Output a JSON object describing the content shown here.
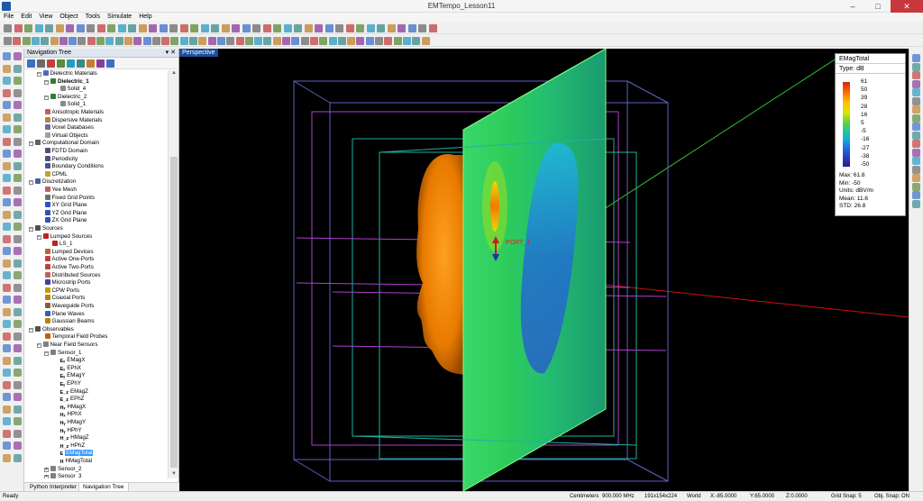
{
  "window": {
    "title": "EMTempo_Lesson11",
    "minimize": "–",
    "maximize": "□",
    "close": "✕"
  },
  "menus": [
    "File",
    "Edit",
    "View",
    "Object",
    "Tools",
    "Simulate",
    "Help"
  ],
  "nav": {
    "header": "Navigation Tree",
    "header_controls": "▾ ✕",
    "tabs": [
      "Python Interpreter",
      "Navigation Tree"
    ],
    "tree": [
      {
        "label": "Dielectric Materials",
        "level": 1,
        "exp": "−",
        "icon": "material-icon",
        "color": "#4a6cc0"
      },
      {
        "label": "Dielectric_1",
        "level": 2,
        "exp": "−",
        "icon": "material-icon",
        "color": "#2e7d32",
        "bold": true
      },
      {
        "label": "Solid_4",
        "level": 3,
        "icon": "solid-icon",
        "color": "#8a8a8a"
      },
      {
        "label": "Dielectric_2",
        "level": 2,
        "exp": "−",
        "icon": "material-icon",
        "color": "#2e7d32"
      },
      {
        "label": "Solid_1",
        "level": 3,
        "icon": "solid-icon",
        "color": "#8a8a8a"
      },
      {
        "label": "Anisotropic Materials",
        "level": 1,
        "icon": "material-icon",
        "color": "#c06060"
      },
      {
        "label": "Dispersive Materials",
        "level": 1,
        "icon": "material-icon",
        "color": "#c08040"
      },
      {
        "label": "Voxel Databases",
        "level": 1,
        "icon": "database-icon",
        "color": "#6070a0"
      },
      {
        "label": "Virtual Objects",
        "level": 1,
        "icon": "object-icon",
        "color": "#a0a0a0"
      },
      {
        "label": "Computational Domain",
        "level": 0,
        "exp": "−",
        "icon": "domain-icon",
        "color": "#606060"
      },
      {
        "label": "FDTD Domain",
        "level": 1,
        "icon": "domain-icon",
        "color": "#505080"
      },
      {
        "label": "Periodicity",
        "level": 1,
        "icon": "periodicity-icon",
        "color": "#505080"
      },
      {
        "label": "Boundary Conditions",
        "level": 1,
        "icon": "boundary-icon",
        "color": "#505080"
      },
      {
        "label": "CPML",
        "level": 1,
        "icon": "cpml-icon",
        "color": "#c0a030"
      },
      {
        "label": "Discretization",
        "level": 0,
        "exp": "−",
        "icon": "mesh-icon",
        "color": "#4060a0"
      },
      {
        "label": "Yee Mesh",
        "level": 1,
        "icon": "mesh-icon",
        "color": "#c06060"
      },
      {
        "label": "Fixed Grid Points",
        "level": 1,
        "icon": "grid-icon",
        "color": "#707070"
      },
      {
        "label": "XY Grid Plane",
        "level": 1,
        "icon": "plane-icon",
        "color": "#3050c0"
      },
      {
        "label": "YZ Grid Plane",
        "level": 1,
        "icon": "plane-icon",
        "color": "#3050c0"
      },
      {
        "label": "ZX Grid Plane",
        "level": 1,
        "icon": "plane-icon",
        "color": "#3050c0"
      },
      {
        "label": "Sources",
        "level": 0,
        "exp": "−",
        "icon": "source-icon",
        "color": "#505050"
      },
      {
        "label": "Lumped Sources",
        "level": 1,
        "exp": "−",
        "icon": "lumped-source-icon",
        "color": "#c02020"
      },
      {
        "label": "LS_1",
        "level": 2,
        "icon": "lumped-source-icon",
        "color": "#c02020"
      },
      {
        "label": "Lumped Devices",
        "level": 1,
        "icon": "device-icon",
        "color": "#c06030"
      },
      {
        "label": "Active One-Ports",
        "level": 1,
        "icon": "port-icon",
        "color": "#c04040"
      },
      {
        "label": "Active Two-Ports",
        "level": 1,
        "icon": "port-icon",
        "color": "#c04040"
      },
      {
        "label": "Distributed Sources",
        "level": 1,
        "icon": "source-icon",
        "color": "#c06060"
      },
      {
        "label": "Microstrip Ports",
        "level": 1,
        "icon": "port-icon",
        "color": "#4040a0"
      },
      {
        "label": "CPW Ports",
        "level": 1,
        "icon": "port-icon",
        "color": "#c0a000"
      },
      {
        "label": "Coaxial Ports",
        "level": 1,
        "icon": "port-icon",
        "color": "#c08000"
      },
      {
        "label": "Waveguide Ports",
        "level": 1,
        "icon": "port-icon",
        "color": "#806040"
      },
      {
        "label": "Plane Waves",
        "level": 1,
        "icon": "wave-icon",
        "color": "#3060c0"
      },
      {
        "label": "Gaussian Beams",
        "level": 1,
        "icon": "beam-icon",
        "color": "#c08000"
      },
      {
        "label": "Observables",
        "level": 0,
        "exp": "−",
        "icon": "observable-icon",
        "color": "#505050"
      },
      {
        "label": "Temporal Field Probes",
        "level": 1,
        "icon": "probe-icon",
        "color": "#c06000"
      },
      {
        "label": "Near Field Sensors",
        "level": 1,
        "exp": "−",
        "icon": "sensor-icon",
        "color": "#808080"
      },
      {
        "label": "Sensor_1",
        "level": 2,
        "exp": "−",
        "icon": "sensor-icon",
        "color": "#808080"
      },
      {
        "label": "EMagX",
        "level": 3,
        "icon": "e-field-icon",
        "glyph": "Eₓ"
      },
      {
        "label": "EPhX",
        "level": 3,
        "icon": "e-field-icon",
        "glyph": "Eₓ"
      },
      {
        "label": "EMagY",
        "level": 3,
        "icon": "e-field-icon",
        "glyph": "Eᵧ"
      },
      {
        "label": "EPhY",
        "level": 3,
        "icon": "e-field-icon",
        "glyph": "Eᵧ"
      },
      {
        "label": "EMagZ",
        "level": 3,
        "icon": "e-field-icon",
        "glyph": "E_z"
      },
      {
        "label": "EPhZ",
        "level": 3,
        "icon": "e-field-icon",
        "glyph": "E_z"
      },
      {
        "label": "HMagX",
        "level": 3,
        "icon": "h-field-icon",
        "glyph": "Hₓ"
      },
      {
        "label": "HPhX",
        "level": 3,
        "icon": "h-field-icon",
        "glyph": "Hₓ"
      },
      {
        "label": "HMagY",
        "level": 3,
        "icon": "h-field-icon",
        "glyph": "Hᵧ"
      },
      {
        "label": "HPhY",
        "level": 3,
        "icon": "h-field-icon",
        "glyph": "Hᵧ"
      },
      {
        "label": "HMagZ",
        "level": 3,
        "icon": "h-field-icon",
        "glyph": "H_z"
      },
      {
        "label": "HPhZ",
        "level": 3,
        "icon": "h-field-icon",
        "glyph": "H_z"
      },
      {
        "label": "EMagTotal",
        "level": 3,
        "icon": "e-field-icon",
        "glyph": "E",
        "selected": true
      },
      {
        "label": "HMagTotal",
        "level": 3,
        "icon": "h-field-icon",
        "glyph": "H"
      },
      {
        "label": "Sensor_2",
        "level": 2,
        "exp": "+",
        "icon": "sensor-icon",
        "color": "#808080"
      },
      {
        "label": "Sensor_3",
        "level": 2,
        "exp": "+",
        "icon": "sensor-icon",
        "color": "#808080"
      }
    ]
  },
  "viewport": {
    "view_label": "Perspective",
    "port_label": "PORT_1"
  },
  "legend": {
    "title": "EMagTotal",
    "type": "Type: dB",
    "ticks": [
      "61",
      "50",
      "39",
      "28",
      "16",
      "5",
      "-5",
      "-16",
      "-27",
      "-38",
      "-50"
    ],
    "stats": [
      "Max: 61.8",
      "Min: -50",
      "Units: dBV/m",
      "Mean: 11.6",
      "STD: 26.8"
    ]
  },
  "status": {
    "ready": "Ready",
    "units": "Centimeters",
    "frequency": "900.000 MHz",
    "grid": "191x154x224",
    "frame": "World",
    "x": "X:-85.0000",
    "y": "Y:65.0000",
    "z": "Z:0.0000",
    "grid_snap": "Grid Snap: 5",
    "obj_snap": "Obj. Snap: ON"
  }
}
